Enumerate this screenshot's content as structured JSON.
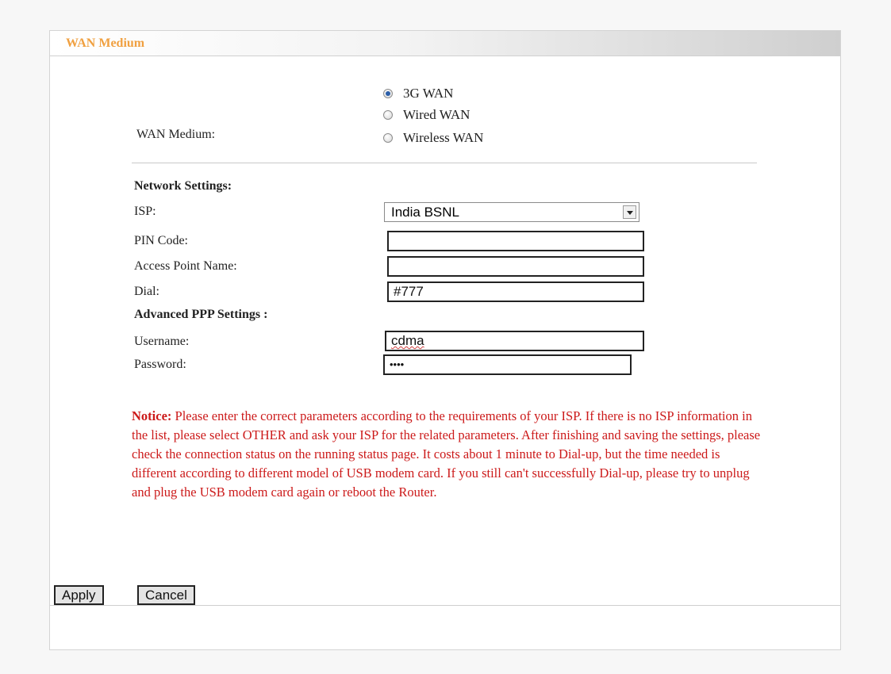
{
  "panel": {
    "title": "WAN Medium"
  },
  "wan_medium": {
    "label": "WAN Medium:",
    "options": [
      {
        "label": "3G WAN",
        "checked": true
      },
      {
        "label": "Wired WAN",
        "checked": false
      },
      {
        "label": "Wireless WAN",
        "checked": false
      }
    ]
  },
  "network_settings": {
    "heading": "Network Settings:",
    "isp_label": "ISP:",
    "isp_value": "India BSNL",
    "pin_label": "PIN Code:",
    "pin_value": "",
    "apn_label": "Access Point Name:",
    "apn_value": "",
    "dial_label": "Dial:",
    "dial_value": "#777"
  },
  "advanced_ppp": {
    "heading": "Advanced PPP Settings :",
    "username_label": "Username:",
    "username_value": "cdma",
    "password_label": "Password:",
    "password_value": "••••"
  },
  "notice": {
    "prefix": "Notice:",
    "text": " Please enter the correct parameters according to the requirements of your ISP. If there is no ISP information in the list, please select OTHER and ask your ISP for the related parameters. After finishing and saving the settings, please check the connection status on the running status page. It costs about 1 minute to Dial-up, but the time needed is different according to different model of USB modem card. If you still can't successfully Dial-up, please try to unplug and plug the USB modem card again or reboot the Router."
  },
  "buttons": {
    "apply": "Apply",
    "cancel": "Cancel"
  },
  "colors": {
    "title": "#f0a040",
    "notice": "#cc1a1a"
  }
}
